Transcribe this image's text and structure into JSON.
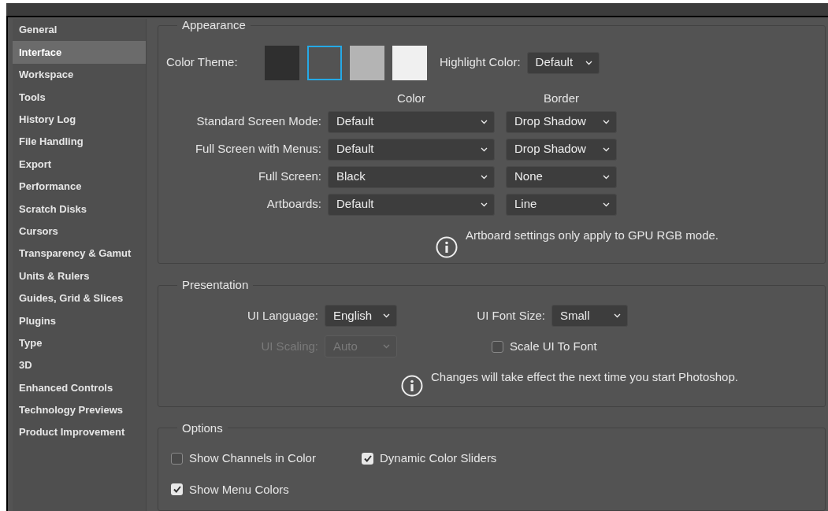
{
  "sidebar": {
    "items": [
      {
        "label": "General",
        "selected": false
      },
      {
        "label": "Interface",
        "selected": true
      },
      {
        "label": "Workspace",
        "selected": false
      },
      {
        "label": "Tools",
        "selected": false
      },
      {
        "label": "History Log",
        "selected": false
      },
      {
        "label": "File Handling",
        "selected": false
      },
      {
        "label": "Export",
        "selected": false
      },
      {
        "label": "Performance",
        "selected": false
      },
      {
        "label": "Scratch Disks",
        "selected": false
      },
      {
        "label": "Cursors",
        "selected": false
      },
      {
        "label": "Transparency & Gamut",
        "selected": false
      },
      {
        "label": "Units & Rulers",
        "selected": false
      },
      {
        "label": "Guides, Grid & Slices",
        "selected": false
      },
      {
        "label": "Plugins",
        "selected": false
      },
      {
        "label": "Type",
        "selected": false
      },
      {
        "label": "3D",
        "selected": false
      },
      {
        "label": "Enhanced Controls",
        "selected": false
      },
      {
        "label": "Technology Previews",
        "selected": false
      },
      {
        "label": "Product Improvement",
        "selected": false
      }
    ]
  },
  "appearance": {
    "title": "Appearance",
    "color_theme": {
      "label": "Color Theme:",
      "swatches": [
        {
          "color": "#2f2f2f",
          "selected": false
        },
        {
          "color": "#535353",
          "selected": true
        },
        {
          "color": "#b4b4b4",
          "selected": false
        },
        {
          "color": "#f0f0f0",
          "selected": false
        }
      ]
    },
    "highlight_color": {
      "label": "Highlight Color:",
      "value": "Default"
    },
    "column_headers": [
      "Color",
      "Border"
    ],
    "rows": [
      {
        "label": "Standard Screen Mode:",
        "color_setting": "Default",
        "border_setting": "Drop Shadow"
      },
      {
        "label": "Full Screen with Menus:",
        "color_setting": "Default",
        "border_setting": "Drop Shadow"
      },
      {
        "label": "Full Screen:",
        "color_setting": "Black",
        "border_setting": "None"
      },
      {
        "label": "Artboards:",
        "color_setting": "Default",
        "border_setting": "Line"
      }
    ],
    "note": "Artboard settings only apply to GPU RGB mode."
  },
  "presentation": {
    "title": "Presentation",
    "ui_language": {
      "label": "UI Language:",
      "value": "English",
      "disabled": false
    },
    "ui_font_size": {
      "label": "UI Font Size:",
      "value": "Small",
      "disabled": false
    },
    "ui_scaling": {
      "label": "UI Scaling:",
      "value": "Auto",
      "disabled": true
    },
    "scale_ui_to_font": {
      "label": "Scale UI To Font",
      "checked": false
    },
    "note": "Changes will take effect the next time you start Photoshop."
  },
  "options": {
    "title": "Options",
    "checkboxes": [
      {
        "label": "Show Channels in Color",
        "checked": false
      },
      {
        "label": "Dynamic Color Sliders",
        "checked": true
      },
      {
        "label": "Show Menu Colors",
        "checked": true
      }
    ]
  }
}
